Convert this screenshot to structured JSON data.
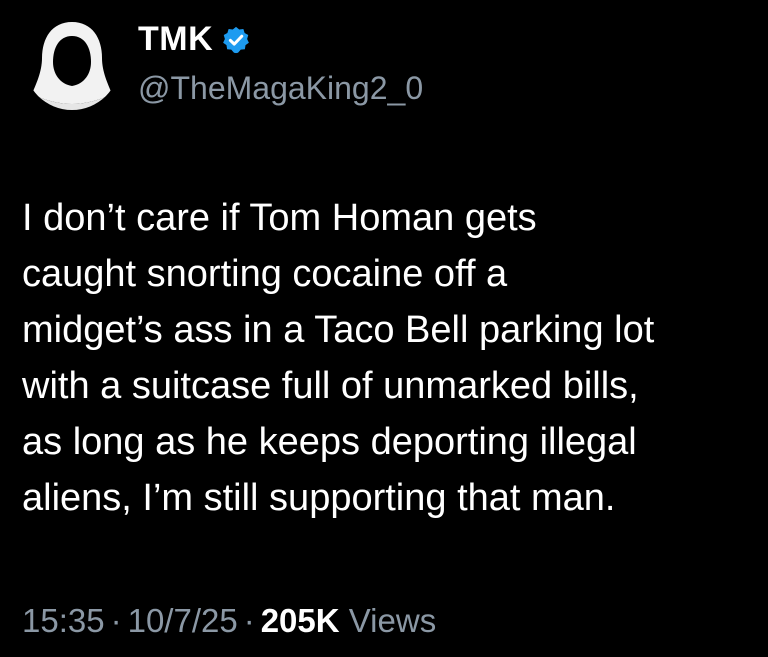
{
  "author": {
    "display_name": "TMK",
    "handle": "@TheMagaKing2_0",
    "verified": true,
    "verified_color": "#1d9bf0",
    "avatar_icon": "hooded-figure-icon"
  },
  "tweet": {
    "text": "I don’t care if Tom Homan gets\ncaught snorting cocaine off a\nmidget’s ass in a Taco Bell parking lot\nwith a suitcase full of unmarked bills,\nas long as he keeps deporting illegal\naliens, I’m still supporting that man."
  },
  "meta": {
    "time": "15:35",
    "separator": "·",
    "date": "10/7/25",
    "views_count": "205K",
    "views_label": "Views"
  },
  "colors": {
    "background": "#000000",
    "text_primary": "#ffffff",
    "text_secondary": "#8b98a5"
  }
}
